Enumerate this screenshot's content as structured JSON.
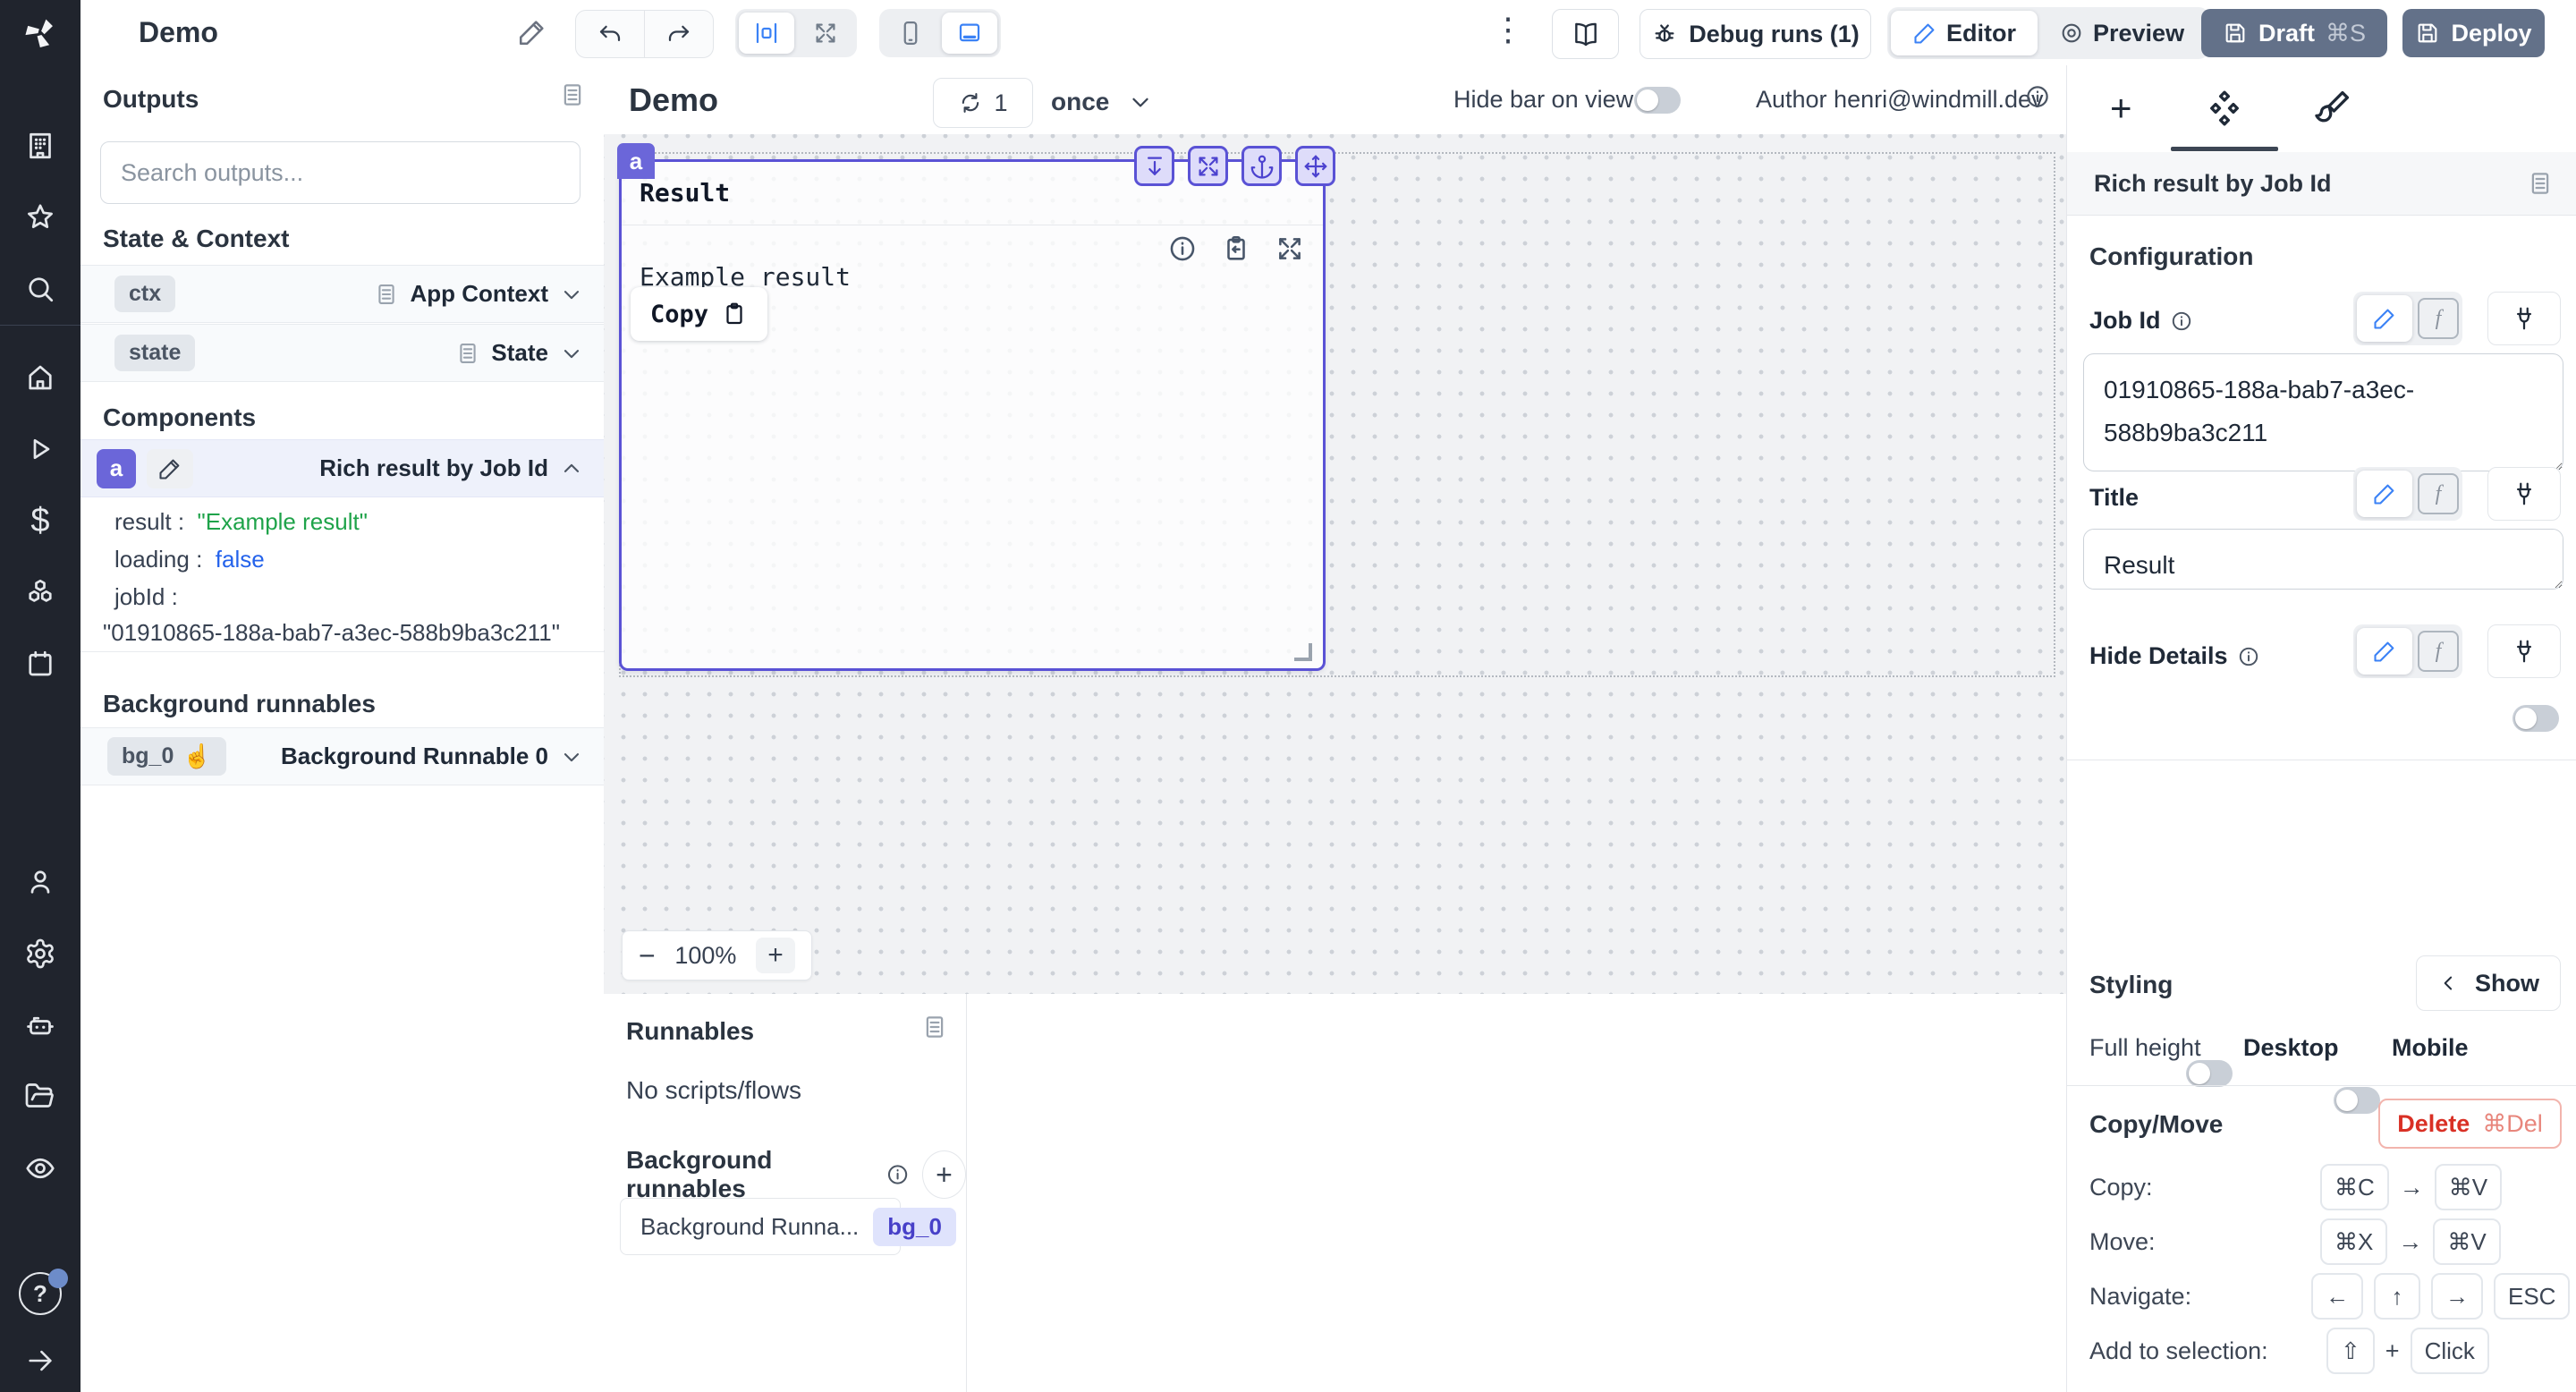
{
  "icons": {
    "kebab": "⋮",
    "dollar": "$",
    "pointer": "☝",
    "question": "?",
    "f": "f",
    "plus": "+",
    "colon": ":",
    "ellipsis": "‹"
  },
  "topbar": {
    "app_title": "Demo",
    "debug_runs_label": "Debug runs (1)",
    "editor_label": "Editor",
    "preview_label": "Preview",
    "draft_label": "Draft",
    "draft_shortcut": "⌘S",
    "deploy_label": "Deploy"
  },
  "left_panel": {
    "outputs_title": "Outputs",
    "search_placeholder": "Search outputs...",
    "state_context_title": "State & Context",
    "ctx": {
      "badge": "ctx",
      "label": "App Context"
    },
    "state": {
      "badge": "state",
      "label": "State"
    },
    "components_title": "Components",
    "component": {
      "badge": "a",
      "label": "Rich result by Job Id",
      "props": [
        {
          "key": "result",
          "value": "\"Example result\""
        },
        {
          "key": "loading",
          "value": "false"
        },
        {
          "key": "jobId",
          "value": ""
        }
      ],
      "job_id_value": "\"01910865-188a-bab7-a3ec-588b9ba3c211\""
    },
    "background_title": "Background runnables",
    "bg_runnable": {
      "badge": "bg_0",
      "label": "Background Runnable 0"
    }
  },
  "canvas": {
    "title": "Demo",
    "refresh_count": "1",
    "mode": "once",
    "hide_bar_label": "Hide bar on view",
    "author_label": "Author henri@windmill.dev",
    "component": {
      "tag": "a",
      "title": "Result",
      "body": "Example result",
      "copy_label": "Copy"
    },
    "zoom": {
      "minus": "−",
      "value": "100%",
      "plus": "+"
    }
  },
  "runnables_panel": {
    "title": "Runnables",
    "empty": "No scripts/flows",
    "background_title": "Background runnables",
    "item": {
      "label": "Background Runna...",
      "badge": "bg_0"
    }
  },
  "right_panel": {
    "header": "Rich result by Job Id",
    "configuration_title": "Configuration",
    "job_id": {
      "label": "Job Id",
      "value": "01910865-188a-bab7-a3ec-588b9ba3c211"
    },
    "title_field": {
      "label": "Title",
      "value": "Result"
    },
    "hide_details": {
      "label": "Hide Details"
    },
    "styling": {
      "title": "Styling",
      "show_label": "Show",
      "full_height": "Full height",
      "desktop": "Desktop",
      "mobile": "Mobile"
    },
    "copy_move": {
      "title": "Copy/Move",
      "delete_label": "Delete",
      "delete_shortcut": "⌘Del",
      "rows": [
        {
          "label": "Copy:",
          "keys": [
            "⌘C",
            "→",
            "⌘V"
          ]
        },
        {
          "label": "Move:",
          "keys": [
            "⌘X",
            "→",
            "⌘V"
          ]
        },
        {
          "label": "Navigate:",
          "keys": [
            "←",
            "↑",
            "→",
            "ESC"
          ]
        },
        {
          "label": "Add to selection:",
          "keys": [
            "⇧",
            "+",
            "Click"
          ]
        }
      ]
    }
  },
  "colors": {
    "accent_indigo": "#5a52d5",
    "accent_blue": "#3b82f6",
    "string_green": "#1fa34a",
    "delete_red": "#d93025",
    "slate_button": "#637189"
  }
}
